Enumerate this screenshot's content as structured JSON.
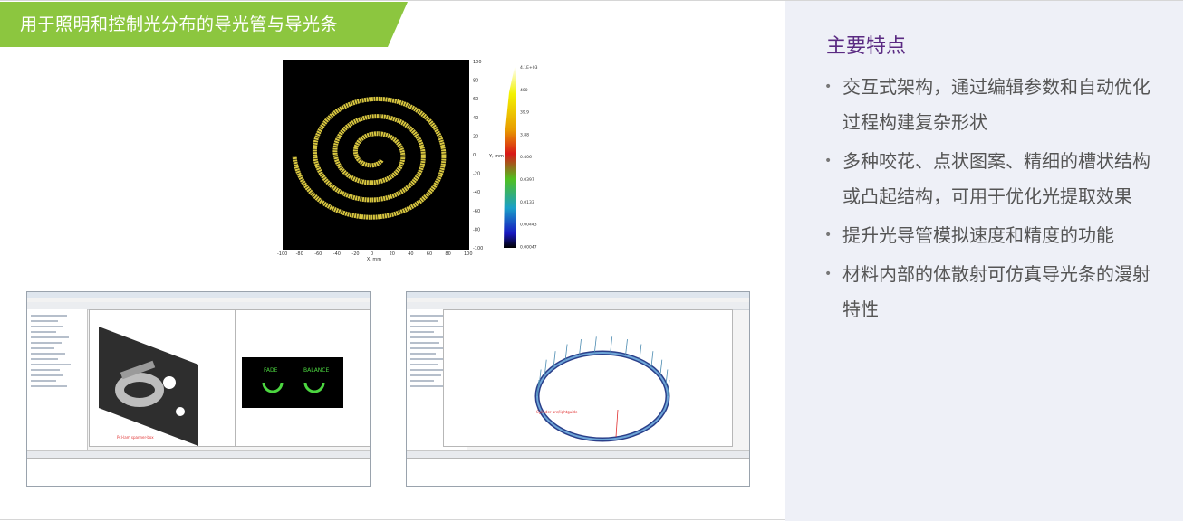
{
  "banner": {
    "title": "用于照明和控制光分布的导光管与导光条"
  },
  "features": {
    "heading": "主要特点",
    "items": [
      "交互式架构，通过编辑参数和自动优化过程构建复杂形状",
      "多种咬花、点状图案、精细的槽状结构或凸起结构，可用于优化光提取效果",
      "提升光导管模拟速度和精度的功能",
      "材料内部的体散射可仿真导光条的漫射特性"
    ]
  },
  "plot": {
    "xlabel": "X, mm",
    "ylabel": "Y, mm",
    "x_ticks": [
      "-100",
      "-80",
      "-60",
      "-40",
      "-20",
      "0",
      "20",
      "40",
      "60",
      "80",
      "100"
    ],
    "y_ticks": [
      "100",
      "80",
      "60",
      "40",
      "20",
      "0",
      "-20",
      "-40",
      "-60",
      "-80",
      "-100"
    ],
    "colorbar_ticks": [
      "4.1E+03",
      "400",
      "39.9",
      "3.88",
      "0.406",
      "0.0397",
      "0.0133",
      "0.00443",
      "0.00047"
    ],
    "colors": {
      "background": "#000000",
      "spiral": "#d8c640"
    }
  },
  "screenshot1": {
    "left_view_caption": "Pcl-lam spanner-box",
    "right_view_labels": [
      "FADE",
      "BALANCE"
    ]
  },
  "screenshot2": {
    "view_caption": "Cylinder arc/lightguide"
  },
  "palette": {
    "banner_green": "#8cc63f",
    "heading_purple": "#5a2a82",
    "panel_bg": "#eef0f7"
  }
}
